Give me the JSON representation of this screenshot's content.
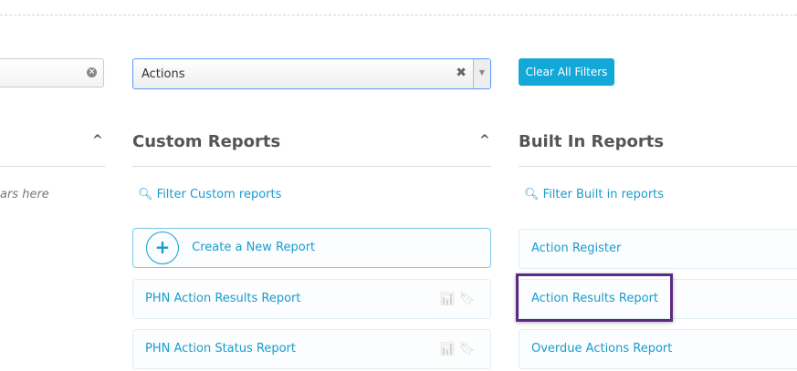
{
  "filters": {
    "left_clear": "×",
    "select_value": "Actions",
    "select_clear": "✖",
    "select_arrow": "▼",
    "clear_all": "Clear All Filters"
  },
  "left_panel": {
    "placeholder_text": "ars here"
  },
  "custom": {
    "title": "Custom Reports",
    "filter": "Filter Custom reports",
    "create": "Create a New Report",
    "items": [
      "PHN Action Results Report",
      "PHN Action Status Report"
    ]
  },
  "builtin": {
    "title": "Built In Reports",
    "filter": "Filter Built in reports",
    "items": [
      "Action Register",
      "Action Results Report",
      "Overdue Actions Report"
    ]
  },
  "colors": {
    "accent": "#12a8d8",
    "highlight": "#5c2a84"
  }
}
